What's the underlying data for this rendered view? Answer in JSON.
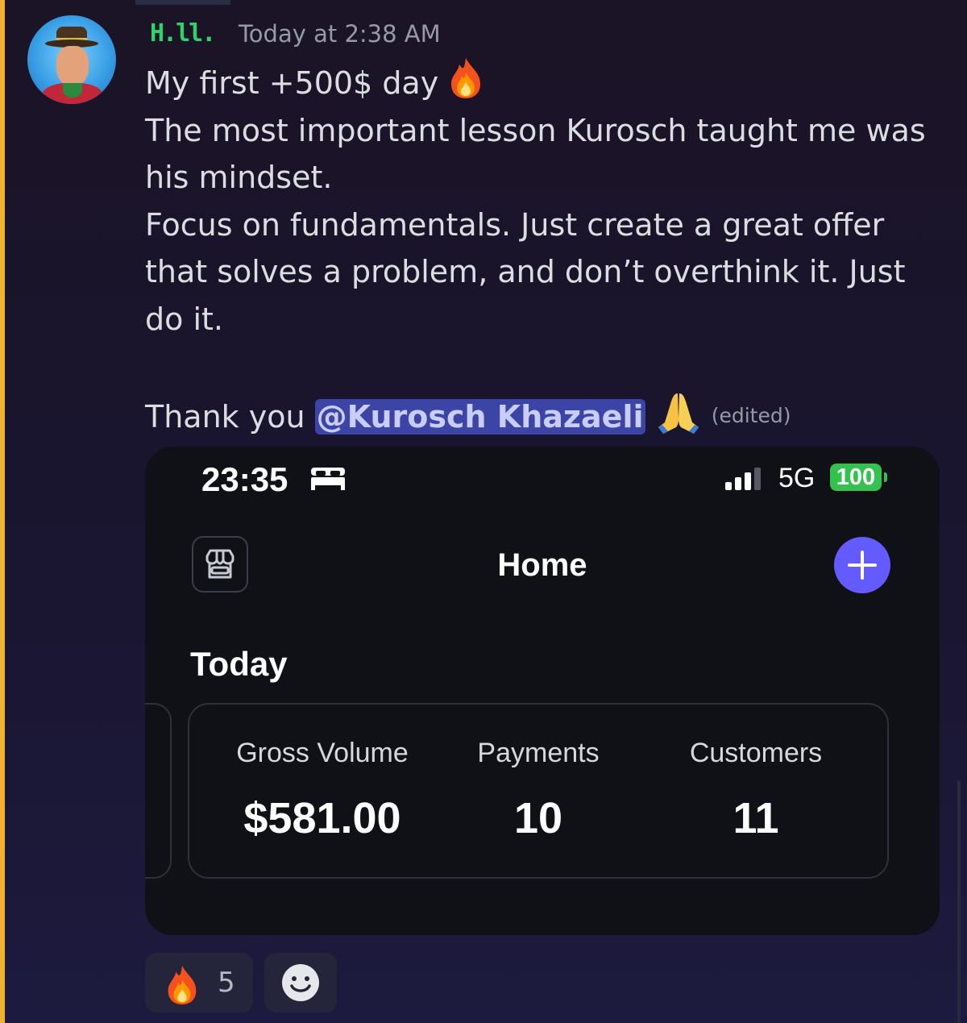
{
  "message": {
    "author": "H.ll.",
    "timestamp": "Today at 2:38 AM",
    "line1_text": "My first +500$ day",
    "line2": "The most important lesson Kurosch taught me was his mindset.",
    "line3": "Focus on fundamentals. Just create a great offer that solves a problem, and don’t overthink it. Just do it.",
    "thanks_text": "Thank you",
    "mention": "@Kurosch Khazaeli",
    "edited_label": "(edited)"
  },
  "attachment": {
    "status_bar": {
      "time": "23:35",
      "network": "5G",
      "battery": "100"
    },
    "title": "Home",
    "section_heading": "Today",
    "stats": [
      {
        "label": "Gross Volume",
        "value": "$581.00"
      },
      {
        "label": "Payments",
        "value": "10"
      },
      {
        "label": "Customers",
        "value": "11"
      }
    ]
  },
  "reactions": [
    {
      "emoji": "fire-emoji",
      "count": "5"
    }
  ],
  "colors": {
    "username": "#2dd46a",
    "mention_bg": "#3c45a5",
    "accent": "#635bff",
    "battery": "#33c24d",
    "left_bar": "#f0b232"
  }
}
